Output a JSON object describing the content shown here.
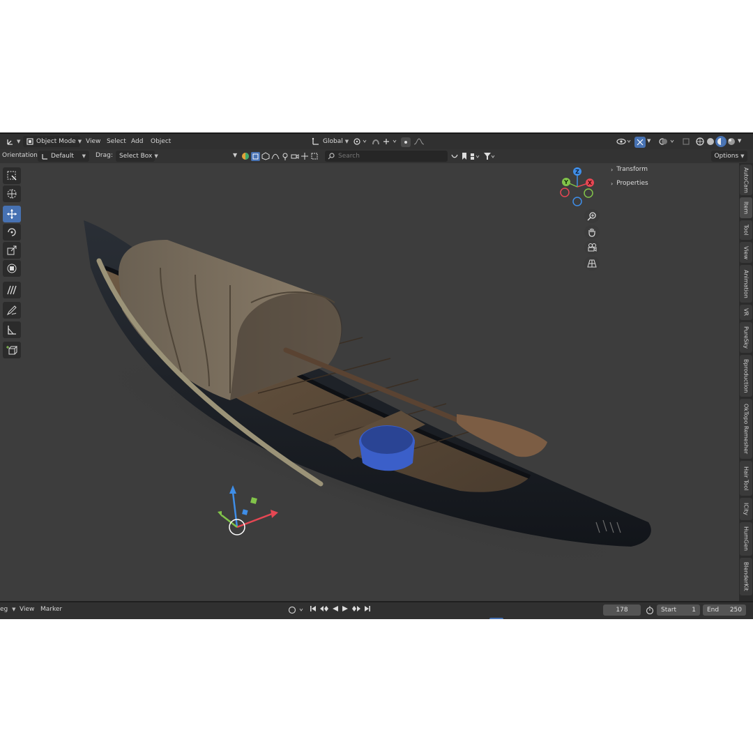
{
  "header": {
    "mode": "Object Mode",
    "menus": [
      "View",
      "Select",
      "Add",
      "Object"
    ],
    "transform_orientation": "Global",
    "options_label": "Options"
  },
  "subheader": {
    "orientation_label": "Orientation:",
    "orientation_value": "Default",
    "drag_label": "Drag:",
    "drag_value": "Select Box",
    "search_placeholder": "Search"
  },
  "toolbar": {
    "tools": [
      "select-box",
      "cursor",
      "move",
      "rotate",
      "scale",
      "transform",
      "annotate",
      "draw",
      "measure",
      "add-cube"
    ],
    "active": "move"
  },
  "npanel": {
    "sections": [
      "Transform",
      "Properties"
    ]
  },
  "side_tabs": [
    "AutoCam",
    "Item",
    "Tool",
    "View",
    "Animation",
    "VR",
    "PureSky",
    "Bproduction",
    "OkTopo Remesher",
    "Hair Tool",
    "ICity",
    "HumGen",
    "BlenderKit"
  ],
  "active_side_tab": "Item",
  "timeline": {
    "menu_partial": "eg",
    "view_label": "View",
    "marker_label": "Marker",
    "current_frame": "178",
    "start_label": "Start",
    "start_value": "1",
    "end_label": "End",
    "end_value": "250"
  },
  "gizmo": {
    "x_label": "X",
    "y_label": "Y",
    "z_label": "Z"
  },
  "colors": {
    "accent": "#4772b3",
    "axis_x": "#e64753",
    "axis_y": "#82c44a",
    "axis_z": "#3f8ee8",
    "bucket": "#3b5fc9"
  }
}
